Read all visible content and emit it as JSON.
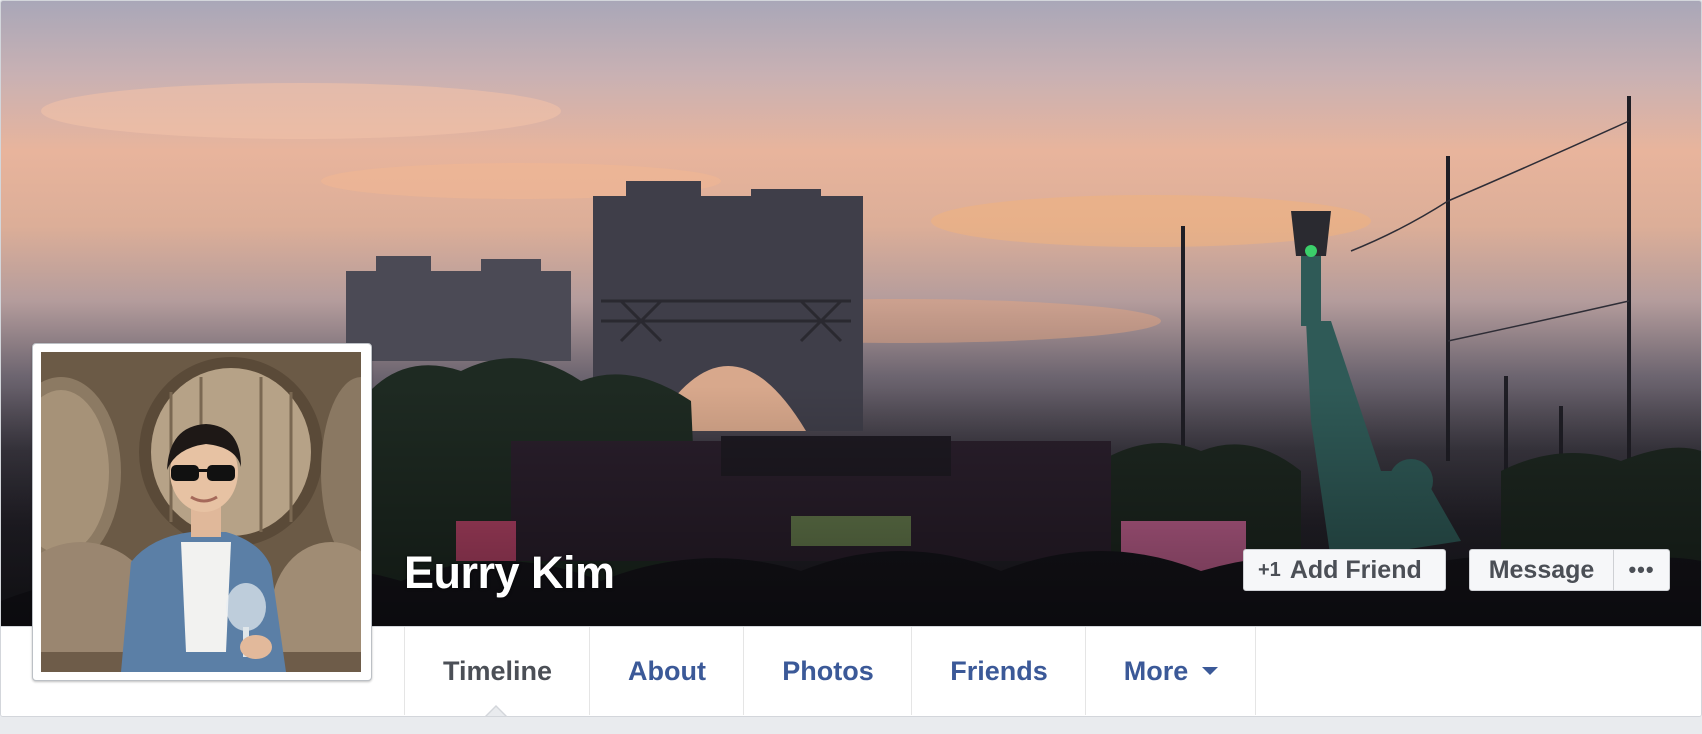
{
  "profile": {
    "name": "Eurry Kim"
  },
  "actions": {
    "add_friend_icon": "+1",
    "add_friend_label": "Add Friend",
    "message_label": "Message",
    "more_label": "•••"
  },
  "tabs": [
    {
      "label": "Timeline",
      "active": true
    },
    {
      "label": "About",
      "active": false
    },
    {
      "label": "Photos",
      "active": false
    },
    {
      "label": "Friends",
      "active": false
    },
    {
      "label": "More",
      "active": false,
      "has_dropdown": true
    }
  ],
  "colors": {
    "link": "#3b5998",
    "active_tab": "#4b4f56",
    "button_bg": "#f6f7f9",
    "page_bg": "#e9ebee"
  }
}
